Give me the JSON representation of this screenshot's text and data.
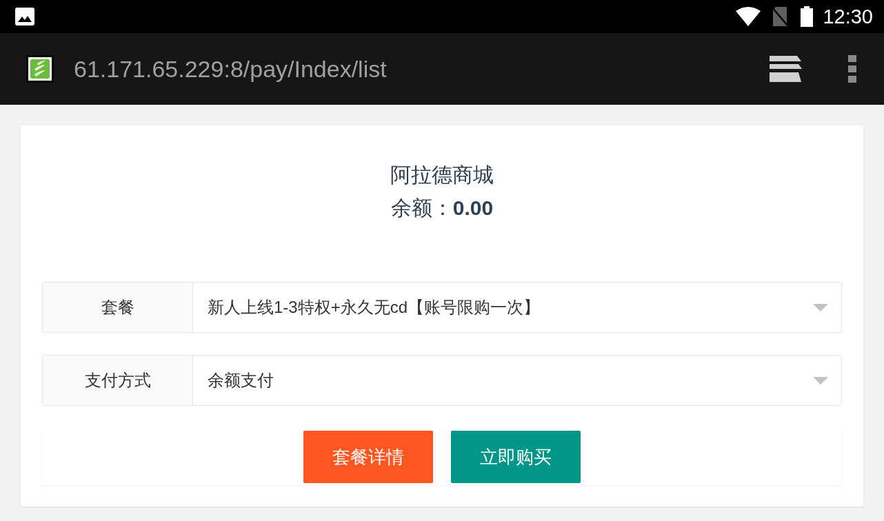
{
  "status_bar": {
    "time": "12:30"
  },
  "browser": {
    "url": "61.171.65.229:8/pay/Index/list"
  },
  "shop": {
    "title": "阿拉德商城",
    "balance": "余额：**0.00**"
  },
  "form": [
    {
      "label": "套餐",
      "value": "新人上线1-3特权+永久无cd【账号限购一次】"
    },
    {
      "label": "支付方式",
      "value": "余额支付"
    }
  ],
  "buttons": [
    {
      "label": "套餐详情",
      "kind": "warm"
    },
    {
      "label": "立即购买",
      "kind": "normal"
    }
  ]
}
